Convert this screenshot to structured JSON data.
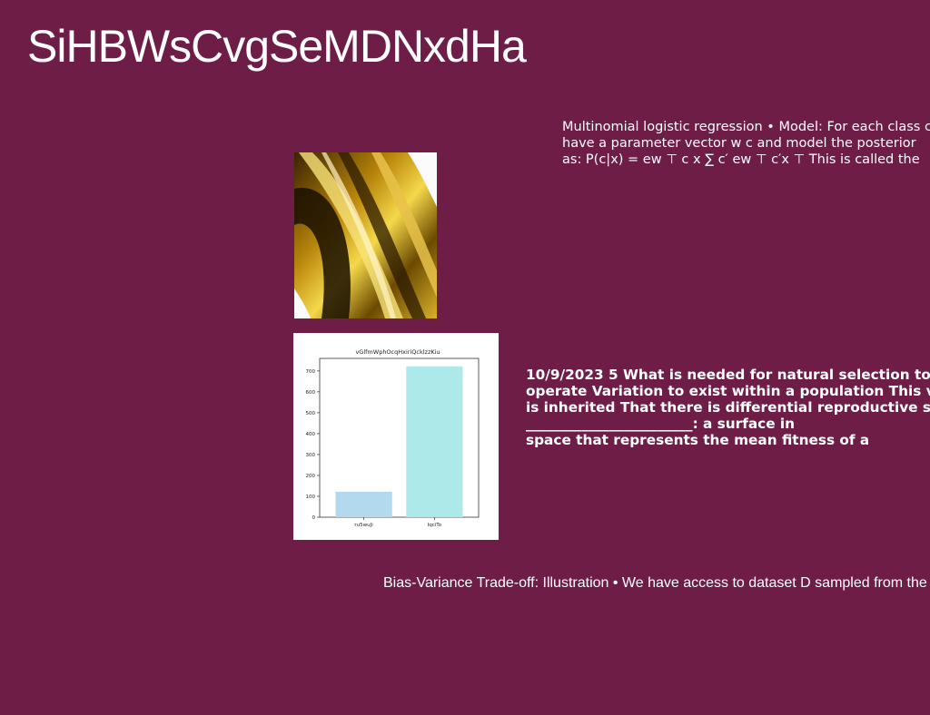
{
  "colors": {
    "background": "#6e1e46",
    "bar_1": "#b3d9ef",
    "bar_2": "#ade9e9"
  },
  "heading": {
    "title": "SiHBWsCvgSeMDNxdHa"
  },
  "top_text": {
    "lines": [
      "Multinomial logistic regression • Model: For each class c, we",
      "have a parameter vector w c and model the posterior",
      "as: P(c|x) = ew ⊤ c x ∑ c′ ew ⊤ c′x ⊤ This is called the"
    ]
  },
  "image": {
    "description": "gold-and-black-abstract-photo"
  },
  "middle_text": {
    "lines": [
      "10/9/2023 5 What is needed for natural selection to",
      "operate Variation to exist within a population This variation",
      "is inherited That there is differential reproductive success",
      "________________________: a surface in",
      "space that represents the mean fitness of a"
    ]
  },
  "bottom_text": {
    "line": "Bias-Variance Trade-off: Illustration • We have access to dataset D sampled from the"
  },
  "chart_data": {
    "type": "bar",
    "title": "vGlfmWphOcqHxiriQcklzzKiu",
    "categories": [
      "ru5wuJi",
      "IqciTo"
    ],
    "values": [
      122,
      722
    ],
    "ylim": [
      0,
      760
    ],
    "yticks": [
      0,
      100,
      200,
      300,
      400,
      500,
      600,
      700
    ],
    "xlabel": "",
    "ylabel": "",
    "grid": false
  }
}
